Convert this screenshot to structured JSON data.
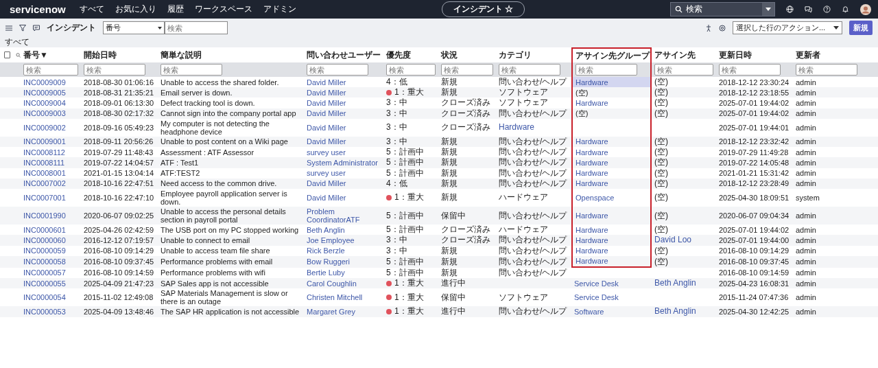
{
  "nav": {
    "logo": "servicenow",
    "menu": [
      "すべて",
      "お気に入り",
      "履歴",
      "ワークスペース",
      "アドミン"
    ],
    "context_title": "インシデント",
    "star": "☆",
    "search": {
      "value": "検索"
    }
  },
  "toolbar": {
    "title": "インシデント",
    "field_select": "番号",
    "search": {
      "placeholder": "検索"
    },
    "action_select": "選択した行のアクション...",
    "new_button": "新規"
  },
  "breadcrumb": "すべて",
  "select_all": {
    "checked": false
  },
  "columns": [
    {
      "label": "番号",
      "sort_mark": "▼",
      "boxed": false,
      "filter_placeholder": "検索"
    },
    {
      "label": "開始日時",
      "boxed": false,
      "filter_placeholder": "検索"
    },
    {
      "label": "簡単な説明",
      "boxed": false,
      "filter_placeholder": "検索"
    },
    {
      "label": "問い合わせユーザー",
      "boxed": false,
      "filter_placeholder": "検索"
    },
    {
      "label": "優先度",
      "boxed": false,
      "filter_placeholder": "検索"
    },
    {
      "label": "状況",
      "boxed": false,
      "filter_placeholder": "検索"
    },
    {
      "label": "カテゴリ",
      "boxed": false,
      "filter_placeholder": "検索"
    },
    {
      "label": "アサイン先グループ",
      "boxed": true,
      "filter_placeholder": "検索"
    },
    {
      "label": "アサイン先",
      "boxed": false,
      "filter_placeholder": "検索"
    },
    {
      "label": "更新日時",
      "boxed": false,
      "filter_placeholder": "検索"
    },
    {
      "label": "更新者",
      "boxed": false,
      "filter_placeholder": "検索"
    }
  ],
  "rows": [
    {
      "boxed": true,
      "group_selected": true,
      "cells": [
        {
          "text": "INC0009009",
          "link": true
        },
        {
          "text": "2018-08-30 01:06:16",
          "link": false
        },
        {
          "text": "Unable to access the shared folder.",
          "link": false
        },
        {
          "text": "David Miller",
          "link": true
        },
        {
          "text": "4：低",
          "link": false,
          "dot": false
        },
        {
          "text": "新規",
          "link": false
        },
        {
          "text": "問い合わせ/ヘルプ",
          "link": false
        },
        {
          "text": "Hardware",
          "link": true
        },
        {
          "text": "(空)",
          "link": false
        },
        {
          "text": "2018-12-12 23:30:24",
          "link": false
        },
        {
          "text": "admin",
          "link": false
        }
      ]
    },
    {
      "boxed": true,
      "group_selected": false,
      "cells": [
        {
          "text": "INC0009005",
          "link": true
        },
        {
          "text": "2018-08-31 21:35:21",
          "link": false
        },
        {
          "text": "Email server is down.",
          "link": false
        },
        {
          "text": "David Miller",
          "link": true
        },
        {
          "text": "1：重大",
          "link": false,
          "dot": true
        },
        {
          "text": "新規",
          "link": false
        },
        {
          "text": "ソフトウェア",
          "link": false
        },
        {
          "text": "(空)",
          "link": false
        },
        {
          "text": "(空)",
          "link": false
        },
        {
          "text": "2018-12-12 23:18:55",
          "link": false
        },
        {
          "text": "admin",
          "link": false
        }
      ]
    },
    {
      "boxed": true,
      "group_selected": false,
      "cells": [
        {
          "text": "INC0009004",
          "link": true
        },
        {
          "text": "2018-09-01 06:13:30",
          "link": false
        },
        {
          "text": "Defect tracking tool is down.",
          "link": false
        },
        {
          "text": "David Miller",
          "link": true
        },
        {
          "text": "3：中",
          "link": false,
          "dot": false
        },
        {
          "text": "クローズ済み",
          "link": false
        },
        {
          "text": "ソフトウェア",
          "link": false
        },
        {
          "text": "Hardware",
          "link": true
        },
        {
          "text": "(空)",
          "link": false
        },
        {
          "text": "2025-07-01 19:44:02",
          "link": false
        },
        {
          "text": "admin",
          "link": false
        }
      ]
    },
    {
      "boxed": true,
      "group_selected": false,
      "cells": [
        {
          "text": "INC0009003",
          "link": true
        },
        {
          "text": "2018-08-30 02:17:32",
          "link": false
        },
        {
          "text": "Cannot sign into the company portal app",
          "link": false
        },
        {
          "text": "David Miller",
          "link": true
        },
        {
          "text": "3：中",
          "link": false,
          "dot": false
        },
        {
          "text": "クローズ済み",
          "link": false
        },
        {
          "text": "問い合わせ/ヘルプ",
          "link": false
        },
        {
          "text": "(空)",
          "link": false
        },
        {
          "text": "(空)",
          "link": false
        },
        {
          "text": "2025-07-01 19:44:02",
          "link": false
        },
        {
          "text": "admin",
          "link": false
        }
      ]
    },
    {
      "boxed": true,
      "group_selected": false,
      "cells": [
        {
          "text": "INC0009002",
          "link": true
        },
        {
          "text": "2018-09-16 05:49:23",
          "link": false
        },
        {
          "text": "My computer is not detecting the headphone device",
          "link": false
        },
        {
          "text": "David Miller",
          "link": true
        },
        {
          "text": "3：中",
          "link": false,
          "dot": false
        },
        {
          "text": "クローズ済み",
          "link": false
        },
        {
          "text": "Hardware",
          "link": true
        },
        null,
        null,
        {
          "text": "2025-07-01 19:44:01",
          "link": false
        },
        {
          "text": "admin",
          "link": false
        }
      ]
    },
    {
      "boxed": true,
      "group_selected": false,
      "cells": [
        {
          "text": "INC0009001",
          "link": true
        },
        {
          "text": "2018-09-11 20:56:26",
          "link": false
        },
        {
          "text": "Unable to post content on a Wiki page",
          "link": false
        },
        {
          "text": "David Miller",
          "link": true
        },
        {
          "text": "3：中",
          "link": false,
          "dot": false
        },
        {
          "text": "新規",
          "link": false
        },
        {
          "text": "問い合わせ/ヘルプ",
          "link": false
        },
        {
          "text": "Hardware",
          "link": true
        },
        {
          "text": "(空)",
          "link": false
        },
        {
          "text": "2018-12-12 23:32:42",
          "link": false
        },
        {
          "text": "admin",
          "link": false
        }
      ]
    },
    {
      "boxed": true,
      "group_selected": false,
      "cells": [
        {
          "text": "INC0008112",
          "link": true
        },
        {
          "text": "2019-07-29 11:48:43",
          "link": false
        },
        {
          "text": "Assessment : ATF Assessor",
          "link": false
        },
        {
          "text": "survey user",
          "link": true
        },
        {
          "text": "5：計画中",
          "link": false,
          "dot": false
        },
        {
          "text": "新規",
          "link": false
        },
        {
          "text": "問い合わせ/ヘルプ",
          "link": false
        },
        {
          "text": "Hardware",
          "link": true
        },
        {
          "text": "(空)",
          "link": false
        },
        {
          "text": "2019-07-29 11:49:28",
          "link": false
        },
        {
          "text": "admin",
          "link": false
        }
      ]
    },
    {
      "boxed": true,
      "group_selected": false,
      "cells": [
        {
          "text": "INC0008111",
          "link": true
        },
        {
          "text": "2019-07-22 14:04:57",
          "link": false
        },
        {
          "text": "ATF : Test1",
          "link": false
        },
        {
          "text": "System Administrator",
          "link": true
        },
        {
          "text": "5：計画中",
          "link": false,
          "dot": false
        },
        {
          "text": "新規",
          "link": false
        },
        {
          "text": "問い合わせ/ヘルプ",
          "link": false
        },
        {
          "text": "Hardware",
          "link": true
        },
        {
          "text": "(空)",
          "link": false
        },
        {
          "text": "2019-07-22 14:05:48",
          "link": false
        },
        {
          "text": "admin",
          "link": false
        }
      ]
    },
    {
      "boxed": true,
      "group_selected": false,
      "cells": [
        {
          "text": "INC0008001",
          "link": true
        },
        {
          "text": "2021-01-15 13:04:14",
          "link": false
        },
        {
          "text": "ATF:TEST2",
          "link": false
        },
        {
          "text": "survey user",
          "link": true
        },
        {
          "text": "5：計画中",
          "link": false,
          "dot": false
        },
        {
          "text": "新規",
          "link": false
        },
        {
          "text": "問い合わせ/ヘルプ",
          "link": false
        },
        {
          "text": "Hardware",
          "link": true
        },
        {
          "text": "(空)",
          "link": false
        },
        {
          "text": "2021-01-21 15:31:42",
          "link": false
        },
        {
          "text": "admin",
          "link": false
        }
      ]
    },
    {
      "boxed": true,
      "group_selected": false,
      "cells": [
        {
          "text": "INC0007002",
          "link": true
        },
        {
          "text": "2018-10-16 22:47:51",
          "link": false
        },
        {
          "text": "Need access to the common drive.",
          "link": false
        },
        {
          "text": "David Miller",
          "link": true
        },
        {
          "text": "4：低",
          "link": false,
          "dot": false
        },
        {
          "text": "新規",
          "link": false
        },
        {
          "text": "問い合わせ/ヘルプ",
          "link": false
        },
        {
          "text": "Hardware",
          "link": true
        },
        {
          "text": "(空)",
          "link": false
        },
        {
          "text": "2018-12-12 23:28:49",
          "link": false
        },
        {
          "text": "admin",
          "link": false
        }
      ]
    },
    {
      "boxed": true,
      "group_selected": false,
      "cells": [
        {
          "text": "INC0007001",
          "link": true
        },
        {
          "text": "2018-10-16 22:47:10",
          "link": false
        },
        {
          "text": "Employee payroll application server is down.",
          "link": false
        },
        {
          "text": "David Miller",
          "link": true
        },
        {
          "text": "1：重大",
          "link": false,
          "dot": true
        },
        {
          "text": "新規",
          "link": false
        },
        {
          "text": "ハードウェア",
          "link": false
        },
        {
          "text": "Openspace",
          "link": true
        },
        {
          "text": "(空)",
          "link": false
        },
        {
          "text": "2025-04-30 18:09:51",
          "link": false
        },
        {
          "text": "system",
          "link": false
        }
      ]
    },
    {
      "boxed": true,
      "group_selected": false,
      "cells": [
        {
          "text": "INC0001990",
          "link": true
        },
        {
          "text": "2020-06-07 09:02:25",
          "link": false
        },
        {
          "text": "Unable to access the personal details section in payroll portal",
          "link": false
        },
        {
          "text": "Problem CoordinatorATF",
          "link": true
        },
        {
          "text": "5：計画中",
          "link": false,
          "dot": false
        },
        {
          "text": "保留中",
          "link": false
        },
        {
          "text": "問い合わせ/ヘルプ",
          "link": false
        },
        {
          "text": "Hardware",
          "link": true
        },
        {
          "text": "(空)",
          "link": false
        },
        {
          "text": "2020-06-07 09:04:34",
          "link": false
        },
        {
          "text": "admin",
          "link": false
        }
      ]
    },
    {
      "boxed": true,
      "group_selected": false,
      "cells": [
        {
          "text": "INC0000601",
          "link": true
        },
        {
          "text": "2025-04-26 02:42:59",
          "link": false
        },
        {
          "text": "The USB port on my PC stopped working",
          "link": false
        },
        {
          "text": "Beth Anglin",
          "link": true
        },
        {
          "text": "5：計画中",
          "link": false,
          "dot": false
        },
        {
          "text": "クローズ済み",
          "link": false
        },
        {
          "text": "ハードウェア",
          "link": false
        },
        {
          "text": "Hardware",
          "link": true
        },
        {
          "text": "(空)",
          "link": false
        },
        {
          "text": "2025-07-01 19:44:02",
          "link": false
        },
        {
          "text": "admin",
          "link": false
        }
      ]
    },
    {
      "boxed": true,
      "group_selected": false,
      "cells": [
        {
          "text": "INC0000060",
          "link": true
        },
        {
          "text": "2016-12-12 07:19:57",
          "link": false
        },
        {
          "text": "Unable to connect to email",
          "link": false
        },
        {
          "text": "Joe Employee",
          "link": true
        },
        {
          "text": "3：中",
          "link": false,
          "dot": false
        },
        {
          "text": "クローズ済み",
          "link": false
        },
        {
          "text": "問い合わせ/ヘルプ",
          "link": false
        },
        {
          "text": "Hardware",
          "link": true
        },
        {
          "text": "David Loo",
          "link": true
        },
        {
          "text": "2025-07-01 19:44:00",
          "link": false
        },
        {
          "text": "admin",
          "link": false
        }
      ]
    },
    {
      "boxed": true,
      "group_selected": false,
      "cells": [
        {
          "text": "INC0000059",
          "link": true
        },
        {
          "text": "2016-08-10 09:14:29",
          "link": false
        },
        {
          "text": "Unable to access team file share",
          "link": false
        },
        {
          "text": "Rick Berzle",
          "link": true
        },
        {
          "text": "3：中",
          "link": false,
          "dot": false
        },
        {
          "text": "新規",
          "link": false
        },
        {
          "text": "問い合わせ/ヘルプ",
          "link": false
        },
        {
          "text": "Hardware",
          "link": true
        },
        {
          "text": "(空)",
          "link": false
        },
        {
          "text": "2016-08-10 09:14:29",
          "link": false
        },
        {
          "text": "admin",
          "link": false
        }
      ]
    },
    {
      "boxed": true,
      "group_selected": false,
      "cells": [
        {
          "text": "INC0000058",
          "link": true
        },
        {
          "text": "2016-08-10 09:37:45",
          "link": false
        },
        {
          "text": "Performance problems with email",
          "link": false
        },
        {
          "text": "Bow Ruggeri",
          "link": true
        },
        {
          "text": "5：計画中",
          "link": false,
          "dot": false
        },
        {
          "text": "新規",
          "link": false
        },
        {
          "text": "問い合わせ/ヘルプ",
          "link": false
        },
        {
          "text": "Hardware",
          "link": true
        },
        {
          "text": "(空)",
          "link": false
        },
        {
          "text": "2016-08-10 09:37:45",
          "link": false
        },
        {
          "text": "admin",
          "link": false
        }
      ]
    },
    {
      "boxed": false,
      "group_selected": false,
      "cells": [
        {
          "text": "INC0000057",
          "link": true
        },
        {
          "text": "2016-08-10 09:14:59",
          "link": false
        },
        {
          "text": "Performance problems with wifi",
          "link": false
        },
        {
          "text": "Bertie Luby",
          "link": true
        },
        {
          "text": "5：計画中",
          "link": false,
          "dot": false
        },
        {
          "text": "新規",
          "link": false
        },
        {
          "text": "問い合わせ/ヘルプ",
          "link": false
        },
        null,
        null,
        {
          "text": "2016-08-10 09:14:59",
          "link": false
        },
        {
          "text": "admin",
          "link": false
        }
      ]
    },
    {
      "boxed": false,
      "group_selected": false,
      "cells": [
        {
          "text": "INC0000055",
          "link": true
        },
        {
          "text": "2025-04-09 21:47:23",
          "link": false
        },
        {
          "text": "SAP Sales app is not accessible",
          "link": false
        },
        {
          "text": "Carol Coughlin",
          "link": true
        },
        {
          "text": "1：重大",
          "link": false,
          "dot": true
        },
        {
          "text": "進行中",
          "link": false
        },
        null,
        {
          "text": "Service Desk",
          "link": true
        },
        {
          "text": "Beth Anglin",
          "link": true
        },
        {
          "text": "2025-04-23 16:08:31",
          "link": false
        },
        {
          "text": "admin",
          "link": false
        }
      ]
    },
    {
      "boxed": false,
      "group_selected": false,
      "cells": [
        {
          "text": "INC0000054",
          "link": true
        },
        {
          "text": "2015-11-02 12:49:08",
          "link": false
        },
        {
          "text": "SAP Materials Management is slow or there is an outage",
          "link": false
        },
        {
          "text": "Christen Mitchell",
          "link": true
        },
        {
          "text": "1：重大",
          "link": false,
          "dot": true
        },
        {
          "text": "保留中",
          "link": false
        },
        {
          "text": "ソフトウェア",
          "link": false
        },
        {
          "text": "Service Desk",
          "link": true
        },
        null,
        {
          "text": "2015-11-24 07:47:36",
          "link": false
        },
        {
          "text": "admin",
          "link": false
        }
      ]
    },
    {
      "boxed": false,
      "group_selected": false,
      "cells": [
        {
          "text": "INC0000053",
          "link": true
        },
        {
          "text": "2025-04-09 13:48:46",
          "link": false
        },
        {
          "text": "The SAP HR application is not accessible",
          "link": false
        },
        {
          "text": "Margaret Grey",
          "link": true
        },
        {
          "text": "1：重大",
          "link": false,
          "dot": true
        },
        {
          "text": "進行中",
          "link": false
        },
        {
          "text": "問い合わせ/ヘルプ",
          "link": false
        },
        {
          "text": "Software",
          "link": true
        },
        {
          "text": "Beth Anglin",
          "link": true
        },
        {
          "text": "2025-04-30 12:42:25",
          "link": false
        },
        {
          "text": "admin",
          "link": false
        }
      ]
    }
  ]
}
